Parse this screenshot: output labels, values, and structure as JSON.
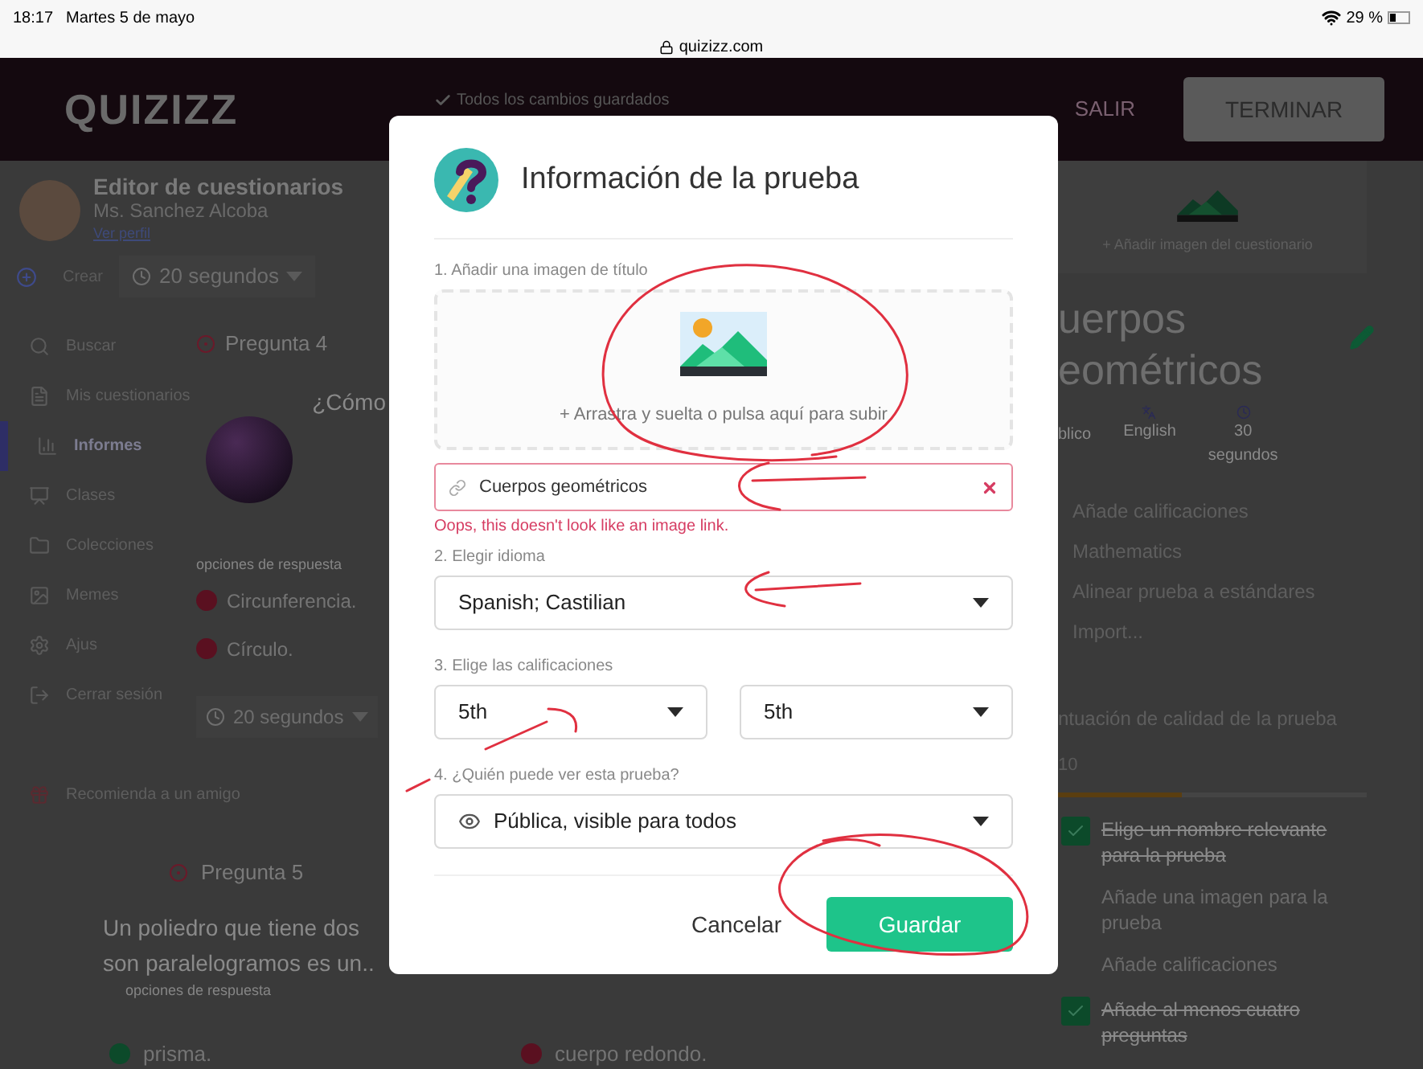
{
  "status_bar": {
    "time": "18:17",
    "date": "Martes 5 de mayo",
    "url": "quizizz.com",
    "battery": "29 %"
  },
  "top_bar": {
    "logo": "QUIZIZZ",
    "save_status": "Todos los cambios guardados",
    "buttons": [
      {
        "label": "SALIR",
        "kind": "text"
      },
      {
        "label": "TERMINAR",
        "kind": "filled"
      }
    ]
  },
  "sidebar": {
    "user_name": "Ms. Sanchez Alcoba",
    "profile_link": "Ver perfil",
    "create_button": "Crear",
    "items": [
      {
        "label": "Buscar",
        "selected": false
      },
      {
        "label": "Mis cuestionarios",
        "selected": false
      },
      {
        "label": "Informes",
        "selected": true
      },
      {
        "label": "Clases",
        "selected": false
      },
      {
        "label": "Colecciones",
        "selected": false
      },
      {
        "label": "Memes",
        "selected": false
      },
      {
        "label": "Ajus",
        "selected": false
      },
      {
        "label": "Cerrar sesión",
        "selected": false
      },
      {
        "label": "Recomienda a un amigo",
        "selected": false
      }
    ]
  },
  "editor": {
    "title": "Editor de cuestionarios",
    "timer": "20 segundos",
    "questions": [
      {
        "label": "Pregunta 4",
        "text_lines": [
          "¿Cómo"
        ],
        "options_label": "opciones de respuesta",
        "answers": [
          {
            "text": "Circunferencia.",
            "correct": false
          },
          {
            "text": "Círculo.",
            "correct": false
          }
        ],
        "timer": "20 segundos"
      },
      {
        "label": "Pregunta 5",
        "text_lines": [
          "Un poliedro que tiene dos",
          "son paralelogramos es un.."
        ],
        "options_label": "opciones de respuesta",
        "answers": [
          {
            "text": "prisma.",
            "correct": true
          },
          {
            "text": "cuerpo redondo.",
            "correct": false
          }
        ]
      }
    ]
  },
  "quiz_panel": {
    "image_link": "+ Añadir imagen del cuestionario",
    "title_lines": [
      "uerpos",
      "eométricos"
    ],
    "meta": [
      {
        "kind": "visibility",
        "label": "blico"
      },
      {
        "kind": "language",
        "label": "English"
      },
      {
        "kind": "duration",
        "label": "30\nsegundos"
      }
    ],
    "settings": [
      "Añade calificaciones",
      "Mathematics",
      "Alinear prueba a estándares",
      "Import..."
    ],
    "quality": {
      "title": "ntuación de calidad de la prueba",
      "score": "10",
      "level": 0.45,
      "checklist": [
        {
          "label": "Elige un nombre relevante para la prueba",
          "checked": true
        },
        {
          "label": "Añade una imagen para la prueba",
          "checked": false
        },
        {
          "label": "Añade calificaciones",
          "checked": false
        },
        {
          "label": "Añade al menos cuatro preguntas",
          "checked": true
        }
      ]
    }
  },
  "dialog": {
    "title": "Información de la prueba",
    "image_section": {
      "label": "1. Añadir una imagen de título",
      "upload_hint": "+ Arrastra y suelta o pulsa aquí para subir",
      "link_value": "Cuerpos geométricos",
      "invalid": true,
      "error": "Oops, this doesn't look like an image link."
    },
    "language": {
      "label": "2. Elegir idioma",
      "value": "Spanish; Castilian"
    },
    "grades": {
      "label": "3. Elige las calificaciones",
      "values": [
        "5th",
        "5th"
      ]
    },
    "visibility": {
      "label": "4. ¿Quién puede ver esta prueba?",
      "value": "Pública, visible para todos"
    },
    "buttons": [
      {
        "label": "Cancelar",
        "kind": "secondary"
      },
      {
        "label": "Guardar",
        "kind": "primary"
      }
    ]
  }
}
